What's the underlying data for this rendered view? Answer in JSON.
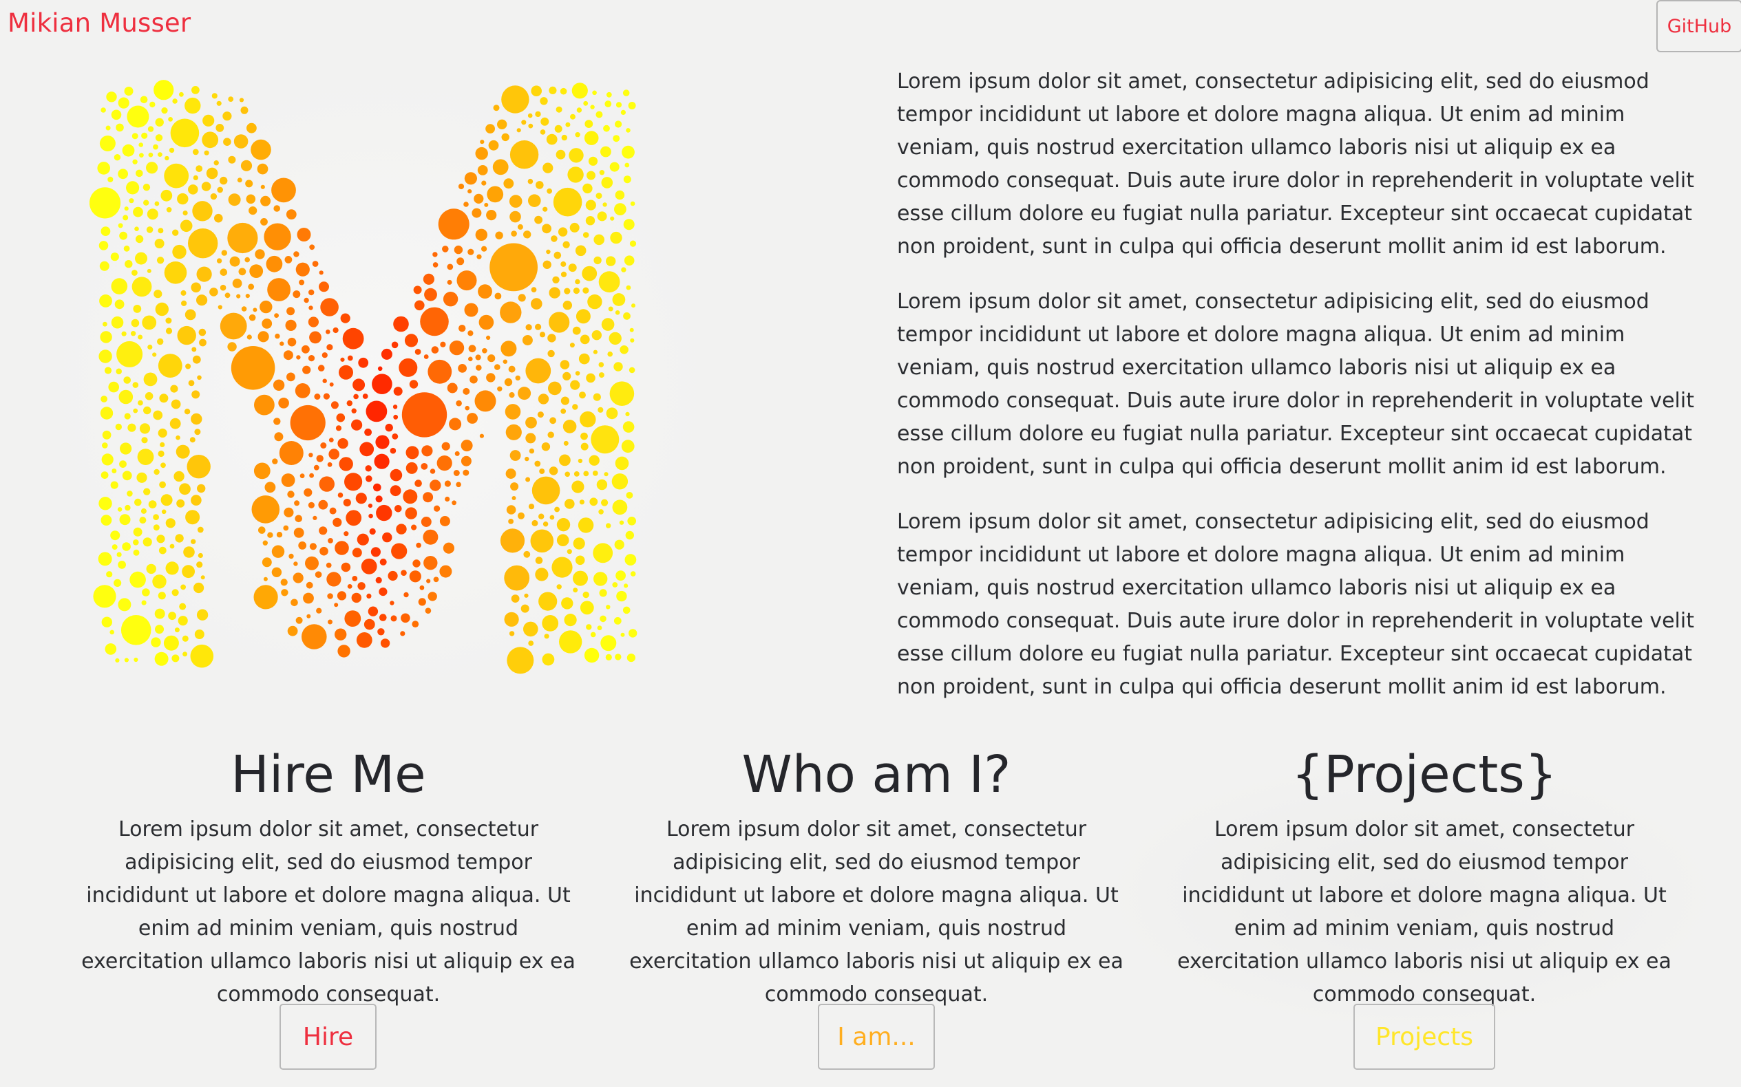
{
  "nav": {
    "brand": "Mikian Musser",
    "github_label": "GitHub"
  },
  "colors": {
    "brand": "#ee2f3f",
    "hire": "#ee2f3f",
    "whoami": "#ffae1f",
    "projects": "#ffe62a"
  },
  "intro": {
    "paragraphs": [
      "Lorem ipsum dolor sit amet, consectetur adipisicing elit, sed do eiusmod tempor incididunt ut labore et dolore magna aliqua. Ut enim ad minim veniam, quis nostrud exercitation ullamco laboris nisi ut aliquip ex ea commodo consequat. Duis aute irure dolor in reprehenderit in voluptate velit esse cillum dolore eu fugiat nulla pariatur. Excepteur sint occaecat cupidatat non proident, sunt in culpa qui officia deserunt mollit anim id est laborum.",
      "Lorem ipsum dolor sit amet, consectetur adipisicing elit, sed do eiusmod tempor incididunt ut labore et dolore magna aliqua. Ut enim ad minim veniam, quis nostrud exercitation ullamco laboris nisi ut aliquip ex ea commodo consequat. Duis aute irure dolor in reprehenderit in voluptate velit esse cillum dolore eu fugiat nulla pariatur. Excepteur sint occaecat cupidatat non proident, sunt in culpa qui officia deserunt mollit anim id est laborum.",
      "Lorem ipsum dolor sit amet, consectetur adipisicing elit, sed do eiusmod tempor incididunt ut labore et dolore magna aliqua. Ut enim ad minim veniam, quis nostrud exercitation ullamco laboris nisi ut aliquip ex ea commodo consequat. Duis aute irure dolor in reprehenderit in voluptate velit esse cillum dolore eu fugiat nulla pariatur. Excepteur sint occaecat cupidatat non proident, sunt in culpa qui officia deserunt mollit anim id est laborum."
    ]
  },
  "cards": [
    {
      "title": "Hire Me",
      "text": "Lorem ipsum dolor sit amet, consectetur adipisicing elit, sed do eiusmod tempor incididunt ut labore et dolore magna aliqua. Ut enim ad minim veniam, quis nostrud exercitation ullamco laboris nisi ut aliquip ex ea commodo consequat.",
      "button": "Hire"
    },
    {
      "title": "Who am I?",
      "text": "Lorem ipsum dolor sit amet, consectetur adipisicing elit, sed do eiusmod tempor incididunt ut labore et dolore magna aliqua. Ut enim ad minim veniam, quis nostrud exercitation ullamco laboris nisi ut aliquip ex ea commodo consequat.",
      "button": "I am..."
    },
    {
      "title": "{Projects}",
      "text": "Lorem ipsum dolor sit amet, consectetur adipisicing elit, sed do eiusmod tempor incididunt ut labore et dolore magna aliqua. Ut enim ad minim veniam, quis nostrud exercitation ullamco laboris nisi ut aliquip ex ea commodo consequat.",
      "button": "Projects"
    }
  ]
}
